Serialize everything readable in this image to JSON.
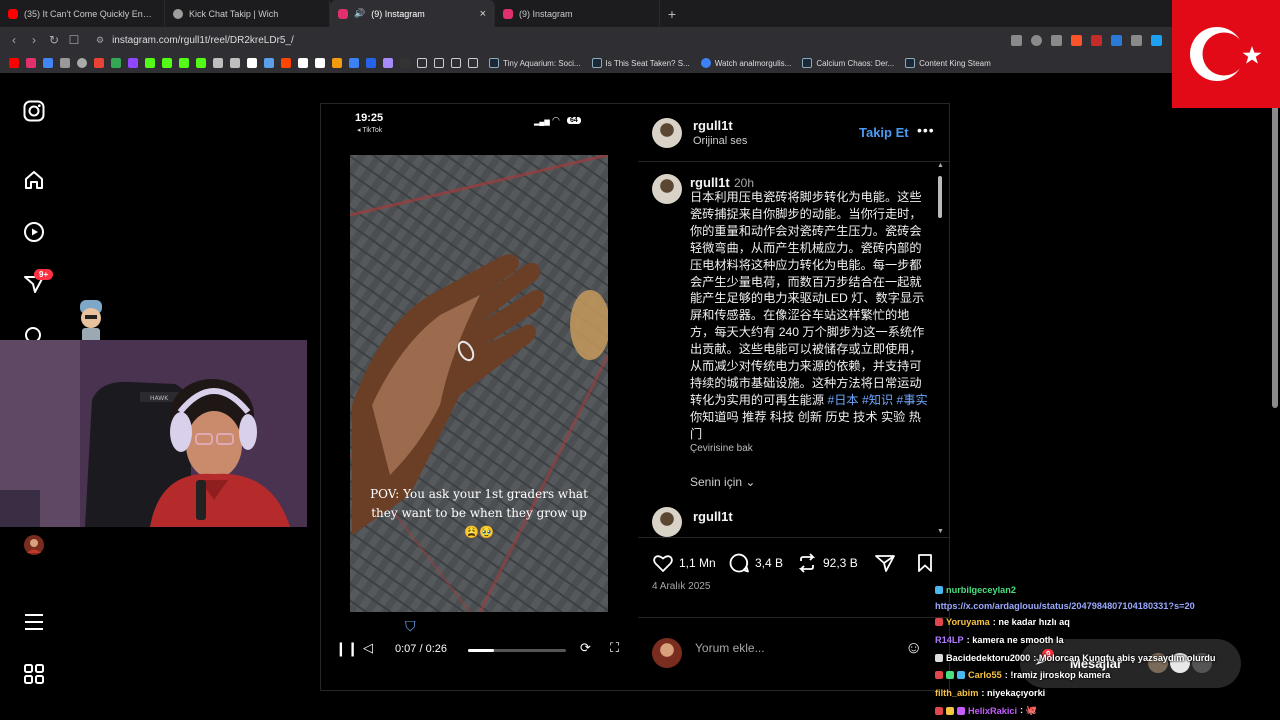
{
  "browser": {
    "tabs": [
      {
        "title": "(35) It Can't Come Quickly Enough -",
        "active": false,
        "favicon_color": "#ff0000"
      },
      {
        "title": "Kick Chat Takip | Wich",
        "active": false,
        "favicon_color": "#9e9e9e"
      },
      {
        "title": "(9) Instagram",
        "active": true,
        "favicon_color": "#e1306c"
      },
      {
        "title": "(9) Instagram",
        "active": false,
        "favicon_color": "#e1306c"
      }
    ],
    "new_tab": "+",
    "url": "instagram.com/rgull1t/reel/DR2kreLDr5_/",
    "bookmarks": [
      {
        "label": "Tiny Aquarium: Soci..."
      },
      {
        "label": "Is This Seat Taken? S..."
      },
      {
        "label": "Watch analmorgulis..."
      },
      {
        "label": "Calcium Chaos: Der..."
      },
      {
        "label": "Content King Steam"
      }
    ]
  },
  "nav": {
    "notifications_badge": "9+"
  },
  "video": {
    "phone_time": "19:25",
    "battery": "64",
    "back_label": "◂ TikTok",
    "overlay_text": "POV: You ask your 1st graders what they want to be when they grow up 😩🥹",
    "time": "0:07 / 0:26",
    "progress": 0.27
  },
  "post": {
    "username": "rgull1t",
    "audio": "Orijinal ses",
    "follow_label": "Takip Et",
    "caption_user": "rgull1t",
    "caption_age": "20h",
    "caption": "日本利用压电瓷砖将脚步转化为电能。这些瓷砖捕捉来自你脚步的动能。当你行走时，你的重量和动作会对瓷砖产生压力。瓷砖会轻微弯曲，从而产生机械应力。瓷砖内部的压电材料将这种应力转化为电能。每一步都会产生少量电荷，而数百万步结合在一起就能产生足够的电力来驱动LED 灯、数字显示屏和传感器。在像涩谷车站这样繁忙的地方，每天大约有 240 万个脚步为这一系统作出贡献。这些电能可以被储存或立即使用，从而减少对传统电力来源的依赖，并支持可持续的城市基础设施。这种方法将日常运动转化为实用的可再生能源",
    "hashtags": "#日本 #知识 #事实",
    "caption_tail": "你知道吗 推荐 科技 创新 历史 技术 实验 热门",
    "translate_label": "Çevirisine bak",
    "for_you_label": "Senin için",
    "next_comment_user": "rgull1t",
    "likes": "1,1 Mn",
    "comments": "3,4 B",
    "reposts": "92,3 B",
    "date": "4 Aralık 2025",
    "comment_placeholder": "Yorum ekle..."
  },
  "messages": {
    "label": "Mesajlar",
    "badge": "9"
  },
  "chat": [
    {
      "user": "nurbilgeceylan2",
      "user_color": "#4ade80",
      "msg": ""
    },
    {
      "user": "",
      "user_color": "#9aa8ff",
      "msg": "https://x.com/ardaglouu/status/2047984807104180331?s=20"
    },
    {
      "user": "Yoruyama",
      "user_color": "#f6c343",
      "msg": ": ne kadar hızlı aq"
    },
    {
      "user": "R14LP",
      "user_color": "#b37bff",
      "msg": ": kamera ne smooth la"
    },
    {
      "user": "Bacidedektoru2000",
      "user_color": "#ffffff",
      "msg": ": Molorcan Kungfu abiş yazsaydım olurdu"
    },
    {
      "user": "Carlo55",
      "user_color": "#f6c343",
      "msg": ": !ramiz jiroskop kamera"
    },
    {
      "user": "filth_abim",
      "user_color": "#f6c343",
      "msg": ": niyekaçıyorki"
    },
    {
      "user": "HelixRakici",
      "user_color": "#c45cff",
      "msg": ": 🐙"
    }
  ],
  "colors": {
    "accent": "#4a9bf5",
    "badge": "#ff3040",
    "flag": "#e30a17"
  }
}
